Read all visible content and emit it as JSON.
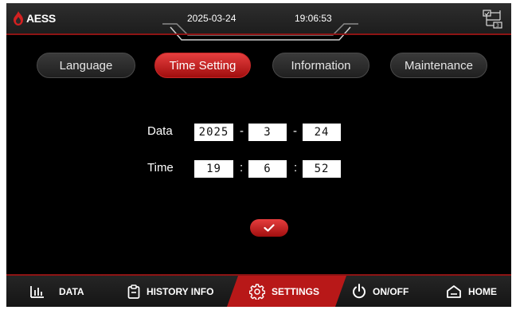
{
  "header": {
    "brand": "AESS",
    "date": "2025-03-24",
    "time": "19:06:53"
  },
  "tabs": [
    {
      "label": "Language",
      "active": false
    },
    {
      "label": "Time Setting",
      "active": true
    },
    {
      "label": "Information",
      "active": false
    },
    {
      "label": "Maintenance",
      "active": false
    }
  ],
  "form": {
    "date_label": "Data",
    "date_year": "2025",
    "date_month": "3",
    "date_day": "24",
    "date_sep": "-",
    "time_label": "Time",
    "time_hour": "19",
    "time_minute": "6",
    "time_second": "52",
    "time_sep": ":"
  },
  "nav": [
    {
      "label": "DATA",
      "icon": "bar-chart-icon",
      "active": false
    },
    {
      "label": "HISTORY INFO",
      "icon": "clipboard-icon",
      "active": false
    },
    {
      "label": "SETTINGS",
      "icon": "gear-icon",
      "active": true
    },
    {
      "label": "ON/OFF",
      "icon": "power-icon",
      "active": false
    },
    {
      "label": "HOME",
      "icon": "home-icon",
      "active": false
    }
  ],
  "colors": {
    "accent": "#c62828",
    "background": "#000000"
  }
}
